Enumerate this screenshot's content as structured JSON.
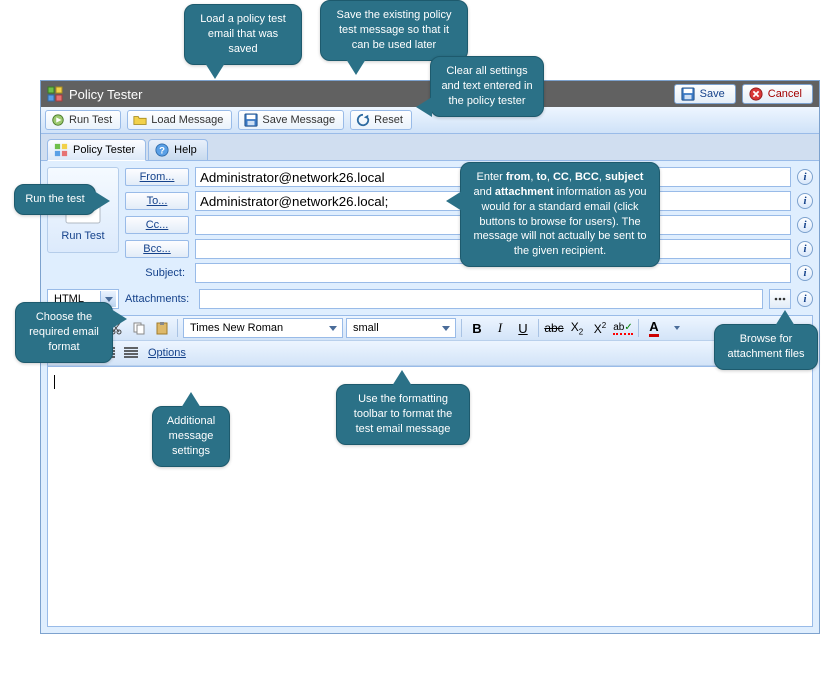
{
  "window": {
    "title": "Policy Tester",
    "save_label": "Save",
    "cancel_label": "Cancel"
  },
  "toolbar": {
    "run_test": "Run Test",
    "load_message": "Load Message",
    "save_message": "Save Message",
    "reset": "Reset"
  },
  "tabs": {
    "policy_tester": "Policy Tester",
    "help": "Help"
  },
  "runpanel": {
    "label": "Run Test"
  },
  "fields": {
    "from_btn": "From...",
    "from_value": "Administrator@network26.local",
    "to_btn": "To...",
    "to_value": "Administrator@network26.local;",
    "cc_btn": "Cc...",
    "cc_value": "",
    "bcc_btn": "Bcc...",
    "bcc_value": "",
    "subject_label": "Subject:",
    "subject_value": "",
    "attachments_label": "Attachments:",
    "attachments_value": ""
  },
  "format_select": {
    "value": "HTML"
  },
  "rtt": {
    "font": "Times New Roman",
    "size": "small",
    "options_link": "Options"
  },
  "callouts": {
    "load": "Load a policy test email that was saved",
    "save": "Save the existing policy test message so that it can be used later",
    "reset": "Clear all settings and text entered in the policy tester",
    "run": "Run the test",
    "fields_html": "Enter <b>from</b>, <b>to</b>, <b>CC</b>, <b>BCC</b>, <b>subject</b> and <b>attachment</b> information as you would for a standard email (click buttons to browse for users). The message will not actually be sent to the given recipient.",
    "format": "Choose the required email format",
    "rtt": "Use the formatting toolbar to format the test email message",
    "browse": "Browse for attachment files",
    "options": "Additional message settings"
  },
  "icons": {
    "app": "policy-tester-icon",
    "save": "floppy-icon",
    "cancel": "cancel-icon",
    "run": "gear-play-icon",
    "load": "folder-open-icon",
    "savemsg": "floppy-icon",
    "reset": "refresh-icon"
  }
}
